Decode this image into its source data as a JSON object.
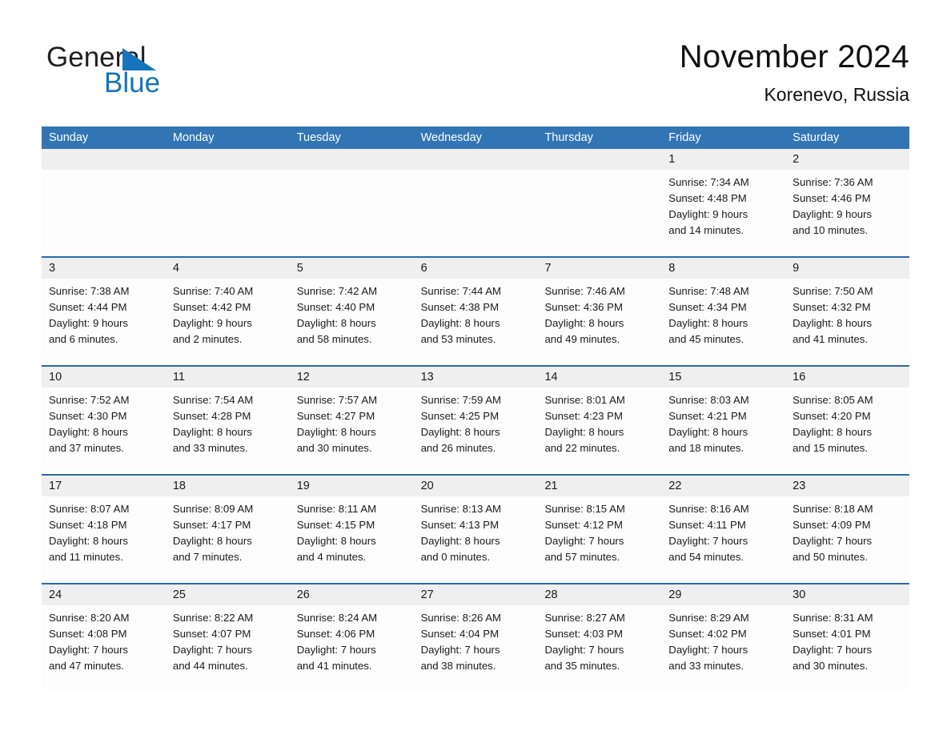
{
  "brand": {
    "name_part1": "General",
    "name_part2": "Blue",
    "accent_color": "#1574bb"
  },
  "header": {
    "month_title": "November 2024",
    "location": "Korenevo, Russia"
  },
  "calendar": {
    "header_color": "#3275b5",
    "day_headers": [
      "Sunday",
      "Monday",
      "Tuesday",
      "Wednesday",
      "Thursday",
      "Friday",
      "Saturday"
    ],
    "weeks": [
      {
        "days": [
          {
            "date": "",
            "lines": []
          },
          {
            "date": "",
            "lines": []
          },
          {
            "date": "",
            "lines": []
          },
          {
            "date": "",
            "lines": []
          },
          {
            "date": "",
            "lines": []
          },
          {
            "date": "1",
            "lines": [
              "Sunrise: 7:34 AM",
              "Sunset: 4:48 PM",
              "Daylight: 9 hours",
              "and 14 minutes."
            ]
          },
          {
            "date": "2",
            "lines": [
              "Sunrise: 7:36 AM",
              "Sunset: 4:46 PM",
              "Daylight: 9 hours",
              "and 10 minutes."
            ]
          }
        ]
      },
      {
        "days": [
          {
            "date": "3",
            "lines": [
              "Sunrise: 7:38 AM",
              "Sunset: 4:44 PM",
              "Daylight: 9 hours",
              "and 6 minutes."
            ]
          },
          {
            "date": "4",
            "lines": [
              "Sunrise: 7:40 AM",
              "Sunset: 4:42 PM",
              "Daylight: 9 hours",
              "and 2 minutes."
            ]
          },
          {
            "date": "5",
            "lines": [
              "Sunrise: 7:42 AM",
              "Sunset: 4:40 PM",
              "Daylight: 8 hours",
              "and 58 minutes."
            ]
          },
          {
            "date": "6",
            "lines": [
              "Sunrise: 7:44 AM",
              "Sunset: 4:38 PM",
              "Daylight: 8 hours",
              "and 53 minutes."
            ]
          },
          {
            "date": "7",
            "lines": [
              "Sunrise: 7:46 AM",
              "Sunset: 4:36 PM",
              "Daylight: 8 hours",
              "and 49 minutes."
            ]
          },
          {
            "date": "8",
            "lines": [
              "Sunrise: 7:48 AM",
              "Sunset: 4:34 PM",
              "Daylight: 8 hours",
              "and 45 minutes."
            ]
          },
          {
            "date": "9",
            "lines": [
              "Sunrise: 7:50 AM",
              "Sunset: 4:32 PM",
              "Daylight: 8 hours",
              "and 41 minutes."
            ]
          }
        ]
      },
      {
        "days": [
          {
            "date": "10",
            "lines": [
              "Sunrise: 7:52 AM",
              "Sunset: 4:30 PM",
              "Daylight: 8 hours",
              "and 37 minutes."
            ]
          },
          {
            "date": "11",
            "lines": [
              "Sunrise: 7:54 AM",
              "Sunset: 4:28 PM",
              "Daylight: 8 hours",
              "and 33 minutes."
            ]
          },
          {
            "date": "12",
            "lines": [
              "Sunrise: 7:57 AM",
              "Sunset: 4:27 PM",
              "Daylight: 8 hours",
              "and 30 minutes."
            ]
          },
          {
            "date": "13",
            "lines": [
              "Sunrise: 7:59 AM",
              "Sunset: 4:25 PM",
              "Daylight: 8 hours",
              "and 26 minutes."
            ]
          },
          {
            "date": "14",
            "lines": [
              "Sunrise: 8:01 AM",
              "Sunset: 4:23 PM",
              "Daylight: 8 hours",
              "and 22 minutes."
            ]
          },
          {
            "date": "15",
            "lines": [
              "Sunrise: 8:03 AM",
              "Sunset: 4:21 PM",
              "Daylight: 8 hours",
              "and 18 minutes."
            ]
          },
          {
            "date": "16",
            "lines": [
              "Sunrise: 8:05 AM",
              "Sunset: 4:20 PM",
              "Daylight: 8 hours",
              "and 15 minutes."
            ]
          }
        ]
      },
      {
        "days": [
          {
            "date": "17",
            "lines": [
              "Sunrise: 8:07 AM",
              "Sunset: 4:18 PM",
              "Daylight: 8 hours",
              "and 11 minutes."
            ]
          },
          {
            "date": "18",
            "lines": [
              "Sunrise: 8:09 AM",
              "Sunset: 4:17 PM",
              "Daylight: 8 hours",
              "and 7 minutes."
            ]
          },
          {
            "date": "19",
            "lines": [
              "Sunrise: 8:11 AM",
              "Sunset: 4:15 PM",
              "Daylight: 8 hours",
              "and 4 minutes."
            ]
          },
          {
            "date": "20",
            "lines": [
              "Sunrise: 8:13 AM",
              "Sunset: 4:13 PM",
              "Daylight: 8 hours",
              "and 0 minutes."
            ]
          },
          {
            "date": "21",
            "lines": [
              "Sunrise: 8:15 AM",
              "Sunset: 4:12 PM",
              "Daylight: 7 hours",
              "and 57 minutes."
            ]
          },
          {
            "date": "22",
            "lines": [
              "Sunrise: 8:16 AM",
              "Sunset: 4:11 PM",
              "Daylight: 7 hours",
              "and 54 minutes."
            ]
          },
          {
            "date": "23",
            "lines": [
              "Sunrise: 8:18 AM",
              "Sunset: 4:09 PM",
              "Daylight: 7 hours",
              "and 50 minutes."
            ]
          }
        ]
      },
      {
        "days": [
          {
            "date": "24",
            "lines": [
              "Sunrise: 8:20 AM",
              "Sunset: 4:08 PM",
              "Daylight: 7 hours",
              "and 47 minutes."
            ]
          },
          {
            "date": "25",
            "lines": [
              "Sunrise: 8:22 AM",
              "Sunset: 4:07 PM",
              "Daylight: 7 hours",
              "and 44 minutes."
            ]
          },
          {
            "date": "26",
            "lines": [
              "Sunrise: 8:24 AM",
              "Sunset: 4:06 PM",
              "Daylight: 7 hours",
              "and 41 minutes."
            ]
          },
          {
            "date": "27",
            "lines": [
              "Sunrise: 8:26 AM",
              "Sunset: 4:04 PM",
              "Daylight: 7 hours",
              "and 38 minutes."
            ]
          },
          {
            "date": "28",
            "lines": [
              "Sunrise: 8:27 AM",
              "Sunset: 4:03 PM",
              "Daylight: 7 hours",
              "and 35 minutes."
            ]
          },
          {
            "date": "29",
            "lines": [
              "Sunrise: 8:29 AM",
              "Sunset: 4:02 PM",
              "Daylight: 7 hours",
              "and 33 minutes."
            ]
          },
          {
            "date": "30",
            "lines": [
              "Sunrise: 8:31 AM",
              "Sunset: 4:01 PM",
              "Daylight: 7 hours",
              "and 30 minutes."
            ]
          }
        ]
      }
    ]
  }
}
